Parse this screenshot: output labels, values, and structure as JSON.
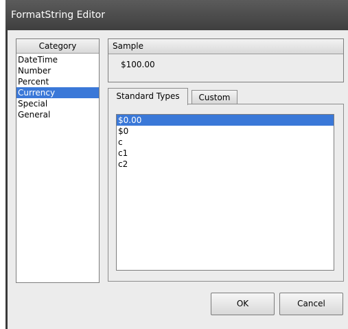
{
  "window": {
    "title": "FormatString Editor"
  },
  "category": {
    "header": "Category",
    "items": [
      {
        "label": "DateTime"
      },
      {
        "label": "Number"
      },
      {
        "label": "Percent"
      },
      {
        "label": "Currency"
      },
      {
        "label": "Special"
      },
      {
        "label": "General"
      }
    ],
    "selected": "Currency"
  },
  "sample": {
    "header": "Sample",
    "value": "$100.00"
  },
  "tabs": [
    {
      "label": "Standard Types",
      "active": true
    },
    {
      "label": "Custom",
      "active": false
    }
  ],
  "standard_types": {
    "items": [
      {
        "label": "$0.00"
      },
      {
        "label": "$0"
      },
      {
        "label": "c"
      },
      {
        "label": "c1"
      },
      {
        "label": "c2"
      }
    ],
    "selected": "$0.00"
  },
  "buttons": {
    "ok": "OK",
    "cancel": "Cancel"
  },
  "colors": {
    "selection": "#3a78d8",
    "titlebar": "#4a4a4a",
    "dialog_bg": "#ececec"
  }
}
